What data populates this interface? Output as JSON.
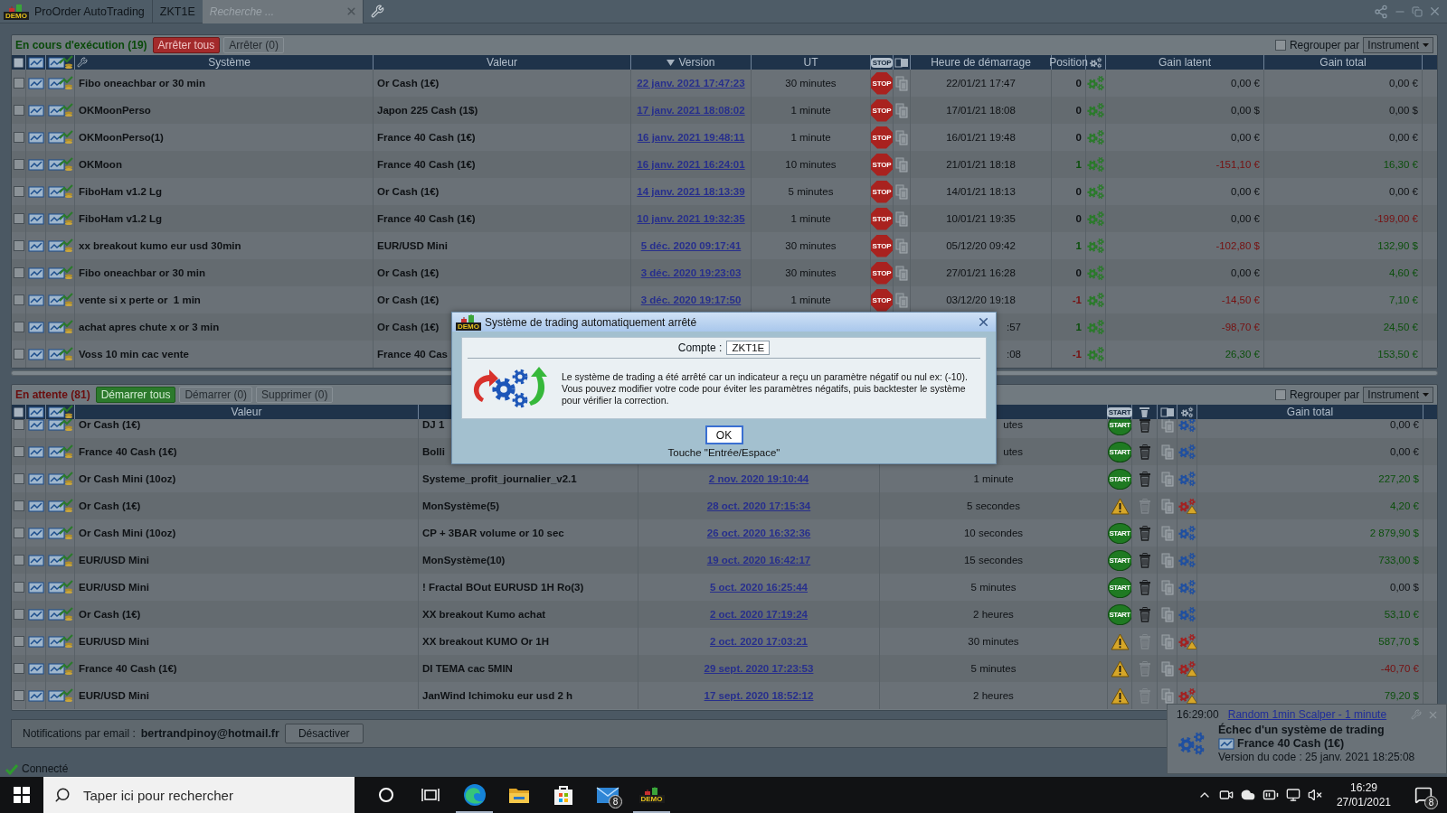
{
  "app": {
    "logo": "DEMO",
    "title": "ProOrder AutoTrading",
    "tab": "ZKT1E",
    "search": {
      "placeholder": "Recherche ..."
    }
  },
  "running": {
    "title": "En cours d'exécution (19)",
    "color": "#0a4a0a",
    "all_checked": false,
    "buttons": [
      {
        "label": "Arrêter tous",
        "kind": "danger",
        "disabled": false
      },
      {
        "label": "Arrêter (0)",
        "kind": "plain",
        "disabled": true
      }
    ],
    "group_by": {
      "label": "Regrouper par",
      "checked": false,
      "value": "Instrument"
    },
    "columns": [
      {
        "kind": "text",
        "label": "Système",
        "sorted": false
      },
      {
        "kind": "text",
        "label": "Valeur",
        "sorted": false
      },
      {
        "kind": "text",
        "label": "Version",
        "sorted": true
      },
      {
        "kind": "text",
        "label": "UT",
        "sorted": false
      },
      {
        "kind": "badge",
        "label": "STOP"
      },
      {
        "kind": "copy"
      },
      {
        "kind": "text",
        "label": "Heure de démarrage",
        "sorted": false
      },
      {
        "kind": "text",
        "label": "Position",
        "sorted": false
      },
      {
        "kind": "gears"
      },
      {
        "kind": "text",
        "label": "Gain latent",
        "sorted": false
      },
      {
        "kind": "text",
        "label": "Gain total",
        "sorted": false
      }
    ],
    "rows": [
      {
        "checked": false,
        "covered": false,
        "system": "Fibo oneachbar or 30 min",
        "instrument": "Or Cash (1€)",
        "version": "22 janv. 2021 17:47:23",
        "ut": "30 minutes",
        "action": "STOP",
        "started": "22/01/21 17:47",
        "position": {
          "text": "0",
          "color": "#0e1114"
        },
        "latent": {
          "text": "0,00 €",
          "color": "#0e1114"
        },
        "total": {
          "text": "0,00 €",
          "color": "#0e1114"
        }
      },
      {
        "checked": false,
        "covered": false,
        "system": "OKMoonPerso",
        "instrument": "Japon 225 Cash (1$)",
        "version": "17 janv. 2021 18:08:02",
        "ut": "1 minute",
        "action": "STOP",
        "started": "17/01/21 18:08",
        "position": {
          "text": "0",
          "color": "#0e1114"
        },
        "latent": {
          "text": "0,00 $",
          "color": "#0e1114"
        },
        "total": {
          "text": "0,00 $",
          "color": "#0e1114"
        }
      },
      {
        "checked": false,
        "covered": false,
        "system": "OKMoonPerso(1)",
        "instrument": "France 40 Cash (1€)",
        "version": "16 janv. 2021 19:48:11",
        "ut": "1 minute",
        "action": "STOP",
        "started": "16/01/21 19:48",
        "position": {
          "text": "0",
          "color": "#0e1114"
        },
        "latent": {
          "text": "0,00 €",
          "color": "#0e1114"
        },
        "total": {
          "text": "0,00 €",
          "color": "#0e1114"
        }
      },
      {
        "checked": false,
        "covered": false,
        "system": "OKMoon",
        "instrument": "France 40 Cash (1€)",
        "version": "16 janv. 2021 16:24:01",
        "ut": "10 minutes",
        "action": "STOP",
        "started": "21/01/21 18:18",
        "position": {
          "text": "1",
          "color": "#0b4f0b"
        },
        "latent": {
          "text": "-151,10 €",
          "color": "#761010"
        },
        "total": {
          "text": "16,30 €",
          "color": "#0b4f0b"
        }
      },
      {
        "checked": false,
        "covered": false,
        "system": "FiboHam v1.2 Lg",
        "instrument": "Or Cash (1€)",
        "version": "14 janv. 2021 18:13:39",
        "ut": "5 minutes",
        "action": "STOP",
        "started": "14/01/21 18:13",
        "position": {
          "text": "0",
          "color": "#0e1114"
        },
        "latent": {
          "text": "0,00 €",
          "color": "#0e1114"
        },
        "total": {
          "text": "0,00 €",
          "color": "#0e1114"
        }
      },
      {
        "checked": false,
        "covered": false,
        "system": "FiboHam v1.2 Lg",
        "instrument": "France 40 Cash (1€)",
        "version": "10 janv. 2021 19:32:35",
        "ut": "1 minute",
        "action": "STOP",
        "started": "10/01/21 19:35",
        "position": {
          "text": "0",
          "color": "#0e1114"
        },
        "latent": {
          "text": "0,00 €",
          "color": "#0e1114"
        },
        "total": {
          "text": "-199,00 €",
          "color": "#761010"
        }
      },
      {
        "checked": false,
        "covered": false,
        "system": "xx breakout kumo eur usd 30min",
        "instrument": "EUR/USD Mini",
        "version": "5 déc. 2020 09:17:41",
        "ut": "30 minutes",
        "action": "STOP",
        "started": "05/12/20 09:42",
        "position": {
          "text": "1",
          "color": "#0b4f0b"
        },
        "latent": {
          "text": "-102,80 $",
          "color": "#761010"
        },
        "total": {
          "text": "132,90 $",
          "color": "#0b4f0b"
        }
      },
      {
        "checked": false,
        "covered": false,
        "system": "Fibo oneachbar or 30 min",
        "instrument": "Or Cash (1€)",
        "version": "3 déc. 2020 19:23:03",
        "ut": "30 minutes",
        "action": "STOP",
        "started": "27/01/21 16:28",
        "position": {
          "text": "0",
          "color": "#0e1114"
        },
        "latent": {
          "text": "0,00 €",
          "color": "#0e1114"
        },
        "total": {
          "text": "4,60 €",
          "color": "#0b4f0b"
        }
      },
      {
        "checked": false,
        "covered": false,
        "system": "vente si x perte or  1 min",
        "instrument": "Or Cash (1€)",
        "version": "3 déc. 2020 19:17:50",
        "ut": "1 minute",
        "action": "STOP",
        "started": "03/12/20 19:18",
        "position": {
          "text": "-1",
          "color": "#761010"
        },
        "latent": {
          "text": "-14,50 €",
          "color": "#761010"
        },
        "total": {
          "text": "7,10 €",
          "color": "#0b4f0b"
        }
      },
      {
        "checked": false,
        "covered": true,
        "system": "achat apres chute x or 3 min",
        "instrument": "Or Cash (1€)",
        "started": ":57",
        "position": {
          "text": "1",
          "color": "#0b4f0b"
        },
        "latent": {
          "text": "-98,70 €",
          "color": "#761010"
        },
        "total": {
          "text": "24,50 €",
          "color": "#0b4f0b"
        }
      },
      {
        "checked": false,
        "covered": true,
        "system": "Voss 10 min cac vente",
        "instrument": "France 40 Cas",
        "started": ":08",
        "position": {
          "text": "-1",
          "color": "#761010"
        },
        "latent": {
          "text": "26,30 €",
          "color": "#0b4f0b"
        },
        "total": {
          "text": "153,50 €",
          "color": "#0b4f0b"
        }
      }
    ]
  },
  "pending": {
    "title": "En attente (81)",
    "color": "#6a0e0e",
    "all_checked": false,
    "buttons": [
      {
        "label": "Démarrer tous",
        "kind": "success",
        "disabled": false
      },
      {
        "label": "Démarrer (0)",
        "kind": "plain",
        "disabled": true
      },
      {
        "label": "Supprimer (0)",
        "kind": "plain",
        "disabled": true
      }
    ],
    "group_by": {
      "label": "Regrouper par",
      "checked": false,
      "value": "Instrument"
    },
    "columns": [
      {
        "kind": "text",
        "label": "Valeur",
        "sorted": false
      },
      {
        "kind": "covered"
      },
      {
        "kind": "covered"
      },
      {
        "kind": "covered"
      },
      {
        "kind": "badge",
        "label": "START"
      },
      {
        "kind": "trash"
      },
      {
        "kind": "copy"
      },
      {
        "kind": "gears"
      },
      {
        "kind": "text",
        "label": "Gain total",
        "sorted": false
      }
    ],
    "rows": [
      {
        "checked": false,
        "covered": true,
        "instrument": "Or Cash (1€)",
        "system": "DJ 1",
        "ut": "utes",
        "failed": false,
        "action": "START",
        "total": {
          "text": "0,00 €",
          "color": "#0e1114"
        }
      },
      {
        "checked": false,
        "covered": true,
        "instrument": "France 40 Cash (1€)",
        "system": "Bolli",
        "ut": "utes",
        "failed": false,
        "action": "START",
        "total": {
          "text": "0,00 €",
          "color": "#0e1114"
        }
      },
      {
        "checked": false,
        "covered": false,
        "instrument": "Or Cash Mini (10oz)",
        "system": "Systeme_profit_journalier_v2.1",
        "version": "2 nov. 2020 19:10:44",
        "ut": "1 minute",
        "failed": false,
        "action": "START",
        "total": {
          "text": "227,20 $",
          "color": "#0b4f0b"
        }
      },
      {
        "checked": false,
        "covered": false,
        "instrument": "Or Cash (1€)",
        "system": "MonSystème(5)",
        "version": "28 oct. 2020 17:15:34",
        "ut": "5 secondes",
        "failed": true,
        "total": {
          "text": "4,20 €",
          "color": "#0b4f0b"
        }
      },
      {
        "checked": false,
        "covered": false,
        "instrument": "Or Cash Mini (10oz)",
        "system": "CP + 3BAR volume or 10 sec",
        "version": "26 oct. 2020 16:32:36",
        "ut": "10 secondes",
        "failed": false,
        "action": "START",
        "total": {
          "text": "2 879,90 $",
          "color": "#0b4f0b"
        }
      },
      {
        "checked": false,
        "covered": false,
        "instrument": "EUR/USD Mini",
        "system": "MonSystème(10)",
        "version": "19 oct. 2020 16:42:17",
        "ut": "15 secondes",
        "failed": false,
        "action": "START",
        "total": {
          "text": "733,00 $",
          "color": "#0b4f0b"
        }
      },
      {
        "checked": false,
        "covered": false,
        "instrument": "EUR/USD Mini",
        "system": "! Fractal BOut EURUSD 1H Ro(3)",
        "version": "5 oct. 2020 16:25:44",
        "ut": "5 minutes",
        "failed": false,
        "action": "START",
        "total": {
          "text": "0,00 $",
          "color": "#0e1114"
        }
      },
      {
        "checked": false,
        "covered": false,
        "instrument": "Or Cash (1€)",
        "system": "XX breakout Kumo achat",
        "version": "2 oct. 2020 17:19:24",
        "ut": "2 heures",
        "failed": false,
        "action": "START",
        "total": {
          "text": "53,10 €",
          "color": "#0b4f0b"
        }
      },
      {
        "checked": false,
        "covered": false,
        "instrument": "EUR/USD Mini",
        "system": "XX breakout KUMO Or 1H",
        "version": "2 oct. 2020 17:03:21",
        "ut": "30 minutes",
        "failed": true,
        "total": {
          "text": "587,70 $",
          "color": "#0b4f0b"
        }
      },
      {
        "checked": false,
        "covered": false,
        "instrument": "France 40 Cash (1€)",
        "system": "DI TEMA cac 5MIN",
        "version": "29 sept. 2020 17:23:53",
        "ut": "5 minutes",
        "failed": true,
        "total": {
          "text": "-40,70 €",
          "color": "#761010"
        }
      },
      {
        "checked": false,
        "covered": false,
        "instrument": "EUR/USD Mini",
        "system": "JanWind Ichimoku eur usd 2 h",
        "version": "17 sept. 2020 18:52:12",
        "ut": "2 heures",
        "failed": true,
        "total": {
          "text": "79,20 $",
          "color": "#0b4f0b"
        }
      }
    ]
  },
  "dialog": {
    "logo": "DEMO",
    "title": "Système de trading automatiquement arrêté",
    "account_label": "Compte :",
    "account": "ZKT1E",
    "message": [
      "Le système de trading a été arrêté car un indicateur a reçu un paramètre négatif ou nul ex: (-10).",
      "Vous pouvez modifier votre code pour éviter les paramètres négatifs, puis backtester le système pour vérifier la correction."
    ],
    "button": "OK",
    "hint": "Touche \"Entrée/Espace\""
  },
  "email_bar": {
    "label": "Notifications par email :",
    "email": "bertrandpinoy@hotmail.fr",
    "button": "Désactiver"
  },
  "status": "Connecté",
  "toast": {
    "time": "16:29:00",
    "link": "Random 1min Scalper - 1 minute",
    "title": "Échec d'un système de trading",
    "instrument": "France 40 Cash (1€)",
    "version": "Version du code : 25 janv. 2021 18:25:08"
  },
  "taskbar": {
    "search": {
      "placeholder": "Taper ici pour rechercher"
    },
    "apps": [
      {
        "kind": "cortana",
        "running": false
      },
      {
        "kind": "taskview",
        "running": false
      },
      {
        "kind": "edge",
        "running": true
      },
      {
        "kind": "explorer",
        "running": false
      },
      {
        "kind": "store",
        "running": false
      },
      {
        "kind": "mail",
        "running": false,
        "badge": "8"
      },
      {
        "kind": "demo",
        "running": true,
        "label": "DEMO"
      }
    ],
    "time": "16:29",
    "date": "27/01/2021",
    "notifications": "8"
  }
}
